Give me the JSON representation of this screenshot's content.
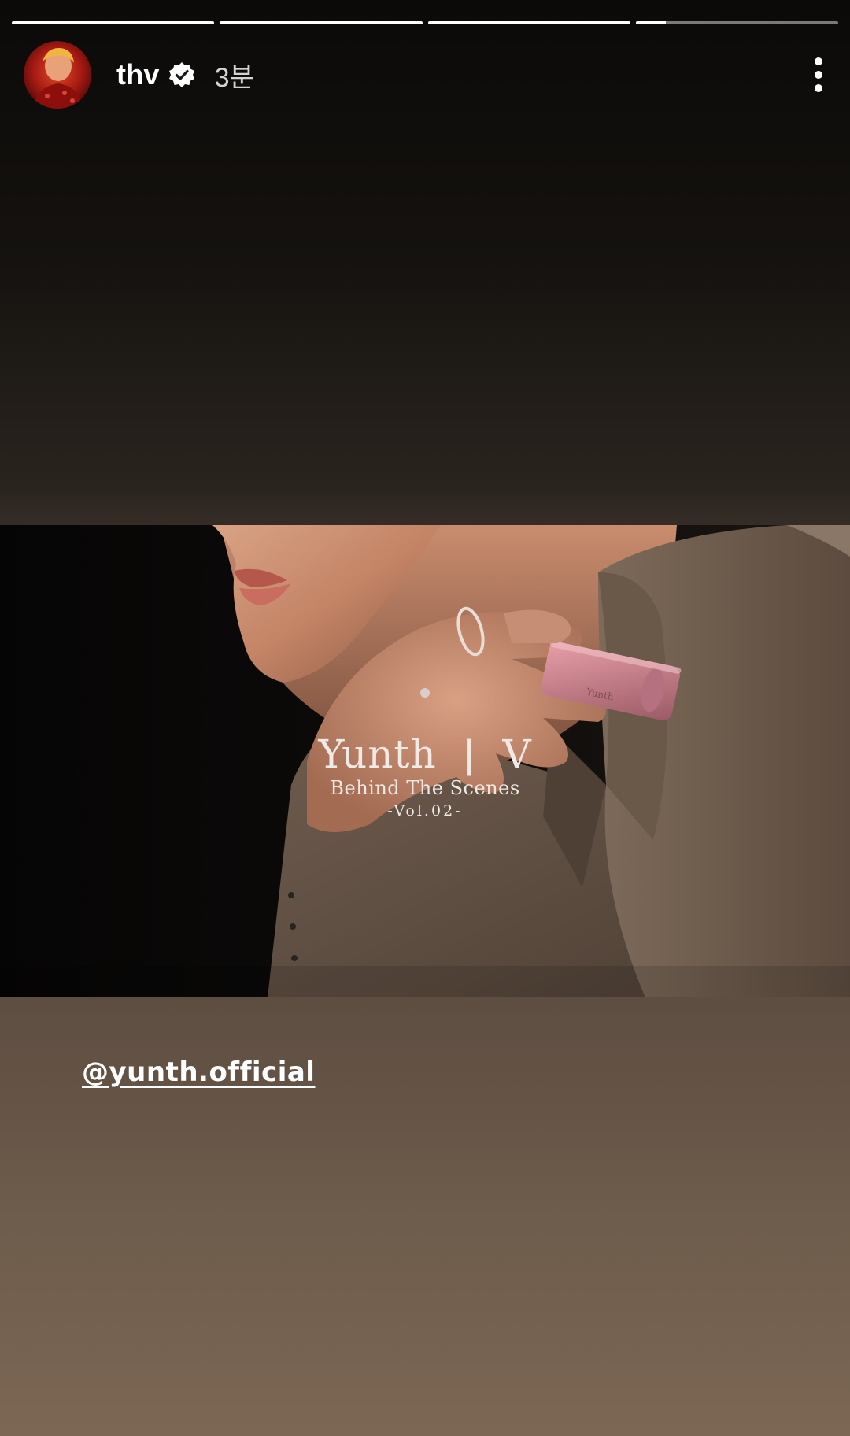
{
  "story": {
    "progress_segments": [
      1,
      1,
      1,
      0.15
    ],
    "user": {
      "username": "thv",
      "verified": true,
      "time_ago": "3분"
    },
    "media": {
      "title": "Yunth",
      "divider": "|",
      "title_right": "V",
      "subtitle": "Behind The Scenes",
      "volume": "-Vol.02-",
      "product_label": "Yunth"
    },
    "mention": "@yunth.official"
  },
  "colors": {
    "progress_active": "#ffffff",
    "progress_inactive": "rgba(255,255,255,0.45)",
    "text_primary": "#ffffff"
  },
  "icons": {
    "verified": "verified-badge-icon",
    "more": "more-vertical-icon"
  }
}
